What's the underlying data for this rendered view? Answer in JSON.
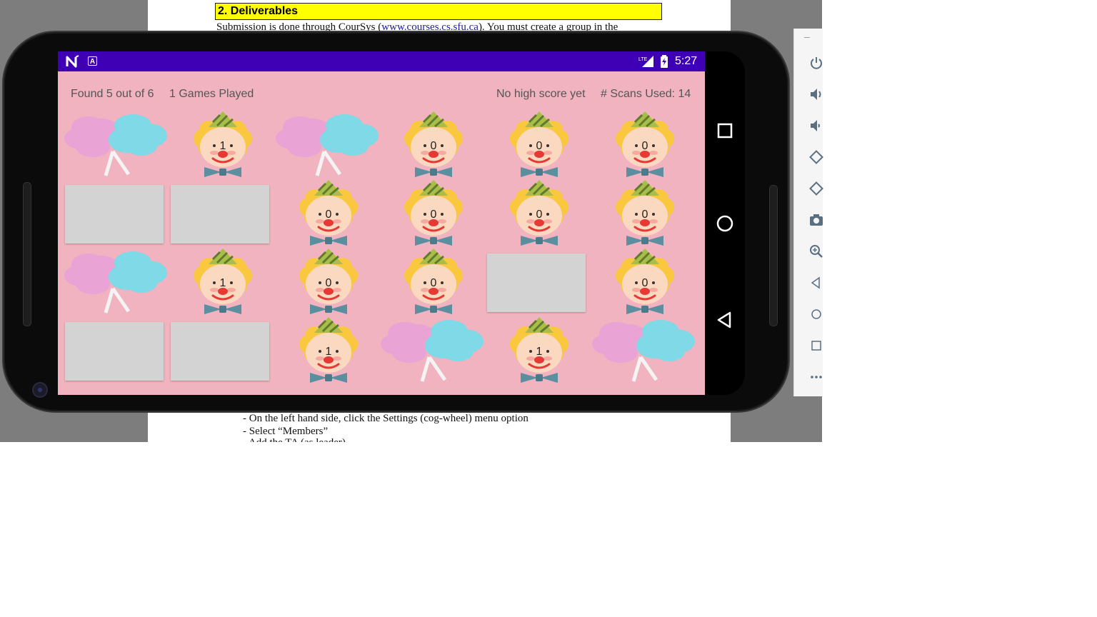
{
  "document": {
    "heading": "2. Deliverables",
    "line_top_prefix": "Submission is done through CourSys (",
    "line_top_link": "www.courses.cs.sfu.ca",
    "line_top_suffix": "). You must create a group in the",
    "bullet_1": "- On the left hand side, click the Settings (cog-wheel) menu option",
    "bullet_2": "- Select “Members”"
  },
  "statusbar": {
    "time": "5:27",
    "app_icon_a": "A",
    "network_label": "LTE",
    "icons": [
      "n-logo-icon",
      "a-badge-icon",
      "lte-signal-icon",
      "battery-charging-icon"
    ]
  },
  "game": {
    "found_text": "Found 5 out of 6",
    "games_played_text": "1 Games Played",
    "high_score_text": "No high score yet",
    "scans_text": "# Scans Used: 14",
    "background_color": "#f0b3bf",
    "board": [
      [
        {
          "type": "candy"
        },
        {
          "type": "clown",
          "count": "1"
        },
        {
          "type": "candy"
        },
        {
          "type": "clown",
          "count": "0"
        },
        {
          "type": "clown",
          "count": "0"
        },
        {
          "type": "clown",
          "count": "0"
        }
      ],
      [
        {
          "type": "hidden"
        },
        {
          "type": "hidden"
        },
        {
          "type": "clown",
          "count": "0"
        },
        {
          "type": "clown",
          "count": "0"
        },
        {
          "type": "clown",
          "count": "0"
        },
        {
          "type": "clown",
          "count": "0"
        }
      ],
      [
        {
          "type": "candy"
        },
        {
          "type": "clown",
          "count": "1"
        },
        {
          "type": "clown",
          "count": "0"
        },
        {
          "type": "clown",
          "count": "0"
        },
        {
          "type": "hidden"
        },
        {
          "type": "clown",
          "count": "0"
        }
      ],
      [
        {
          "type": "hidden"
        },
        {
          "type": "hidden"
        },
        {
          "type": "clown",
          "count": "1"
        },
        {
          "type": "candy"
        },
        {
          "type": "clown",
          "count": "1"
        },
        {
          "type": "candy"
        }
      ]
    ]
  },
  "android_nav": [
    "recents-square-icon",
    "home-circle-icon",
    "back-triangle-icon"
  ],
  "emulator_toolbar": [
    "power-icon",
    "volume-up-icon",
    "volume-down-icon",
    "rotate-left-icon",
    "rotate-right-icon",
    "camera-icon",
    "zoom-icon",
    "back-icon",
    "home-icon",
    "overview-icon",
    "more-icon"
  ]
}
